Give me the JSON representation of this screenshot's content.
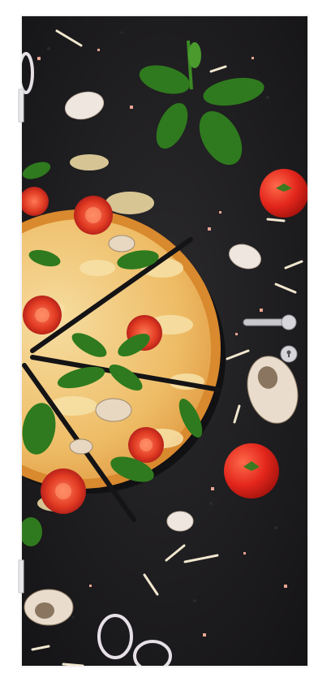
{
  "scene": {
    "subject": "door-sticker-pizza",
    "colors": {
      "door_frame": "#ffffff",
      "board": "#1c1b1d",
      "crust": "#e39a3c",
      "cheese": "#f2d491",
      "tomato": "#e3261c",
      "basil": "#2f7a1e",
      "mushroom": "#e9dccd",
      "garlic": "#efe7df",
      "salt": "#e8a593",
      "handle": "#c8c8cc"
    },
    "icons": [
      "door-handle-icon",
      "keyhole-icon",
      "hinge-icon"
    ]
  }
}
